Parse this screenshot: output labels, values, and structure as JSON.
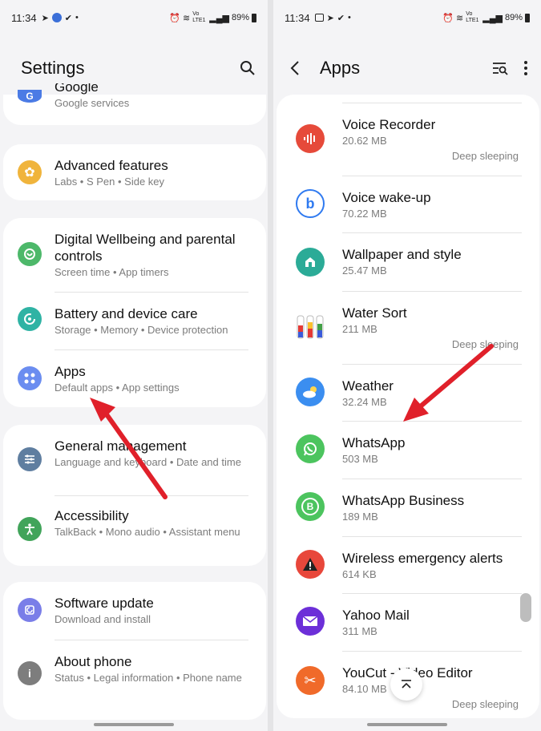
{
  "left": {
    "status": {
      "time": "11:34",
      "battery": "89%",
      "net": "Vo LTE1"
    },
    "title": "Settings",
    "rows": [
      {
        "title": "Google",
        "subtitle": "Google services"
      },
      {
        "title": "Advanced features",
        "subtitle": "Labs  •  S Pen  •  Side key"
      },
      {
        "title": "Digital Wellbeing and parental controls",
        "subtitle": "Screen time  •  App timers"
      },
      {
        "title": "Battery and device care",
        "subtitle": "Storage  •  Memory  •  Device protection"
      },
      {
        "title": "Apps",
        "subtitle": "Default apps  •  App settings"
      },
      {
        "title": "General management",
        "subtitle": "Language and keyboard  •  Date and time"
      },
      {
        "title": "Accessibility",
        "subtitle": "TalkBack  •  Mono audio  •  Assistant menu"
      },
      {
        "title": "Software update",
        "subtitle": "Download and install"
      },
      {
        "title": "About phone",
        "subtitle": "Status  •  Legal information  •  Phone name"
      }
    ]
  },
  "right": {
    "status": {
      "time": "11:34",
      "battery": "89%",
      "net": "Vo LTE1"
    },
    "title": "Apps",
    "deep_label": "Deep sleeping",
    "apps": [
      {
        "name": "Voice Recorder",
        "size": "20.62 MB",
        "deep": true
      },
      {
        "name": "Voice wake-up",
        "size": "70.22 MB",
        "deep": false
      },
      {
        "name": "Wallpaper and style",
        "size": "25.47 MB",
        "deep": false
      },
      {
        "name": "Water Sort",
        "size": "211 MB",
        "deep": true
      },
      {
        "name": "Weather",
        "size": "32.24 MB",
        "deep": false
      },
      {
        "name": "WhatsApp",
        "size": "503 MB",
        "deep": false
      },
      {
        "name": "WhatsApp Business",
        "size": "189 MB",
        "deep": false
      },
      {
        "name": "Wireless emergency alerts",
        "size": "614 KB",
        "deep": false
      },
      {
        "name": "Yahoo Mail",
        "size": "311 MB",
        "deep": false
      },
      {
        "name": "YouCut - Video Editor",
        "size": "84.10 MB",
        "deep": true
      }
    ]
  },
  "colors": {
    "arrow": "#e0202a",
    "accent": "#3d6bd6"
  }
}
